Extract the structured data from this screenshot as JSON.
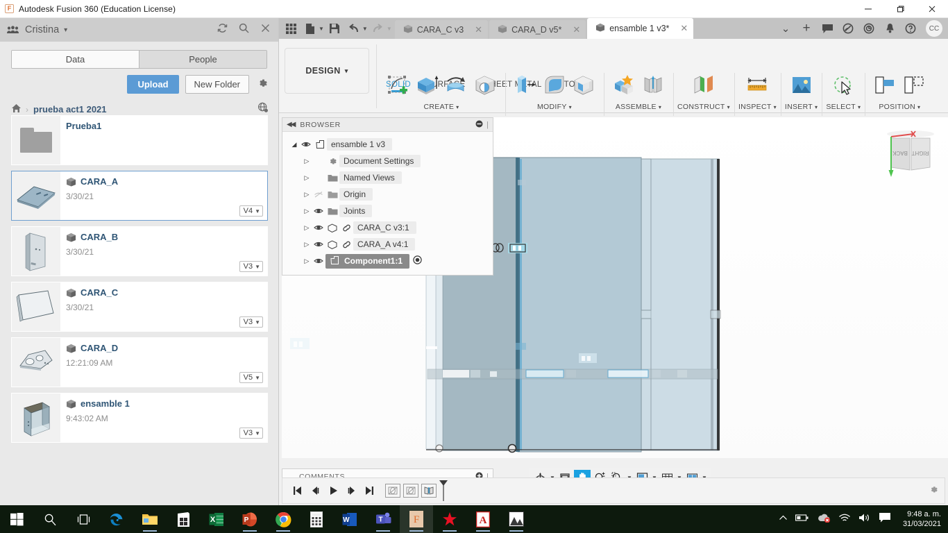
{
  "window": {
    "title": "Autodesk Fusion 360 (Education License)",
    "app_icon": "fusion-logo-icon",
    "minimize": "—",
    "maximize": "❐",
    "close": "✕"
  },
  "data_panel": {
    "user": "Cristina",
    "user_caret": "▾",
    "header_icons": [
      "refresh-icon",
      "search-icon",
      "close-icon"
    ],
    "tabs": [
      {
        "label": "Data",
        "active": true
      },
      {
        "label": "People",
        "active": false
      }
    ],
    "upload_label": "Upload",
    "new_folder_label": "New Folder",
    "settings_icon": "gear-icon",
    "breadcrumb": {
      "home_icon": "home-icon",
      "separator": "›",
      "current": "prueba act1 2021",
      "globe_icon": "globe-icon"
    },
    "items": [
      {
        "name": "Prueba1",
        "date": "",
        "version": "",
        "type": "folder",
        "selected": false
      },
      {
        "name": "CARA_A",
        "date": "3/30/21",
        "version": "V4",
        "type": "file",
        "selected": true
      },
      {
        "name": "CARA_B",
        "date": "3/30/21",
        "version": "V3",
        "type": "file",
        "selected": false
      },
      {
        "name": "CARA_C",
        "date": "3/30/21",
        "version": "V3",
        "type": "file",
        "selected": false
      },
      {
        "name": "CARA_D",
        "date": "12:21:09 AM",
        "version": "V5",
        "type": "file",
        "selected": false
      },
      {
        "name": "ensamble 1",
        "date": "9:43:02 AM",
        "version": "V3",
        "type": "file",
        "selected": false
      }
    ]
  },
  "quick_access": {
    "grid_icon": "app-grid-icon",
    "new_icon": "new-document-icon",
    "save_icon": "save-icon",
    "undo_icon": "undo-icon",
    "redo_icon": "redo-icon"
  },
  "document_tabs": [
    {
      "label": "CARA_C v3",
      "active": false,
      "close": "✕"
    },
    {
      "label": "CARA_D v5*",
      "active": false,
      "close": "✕"
    },
    {
      "label": "ensamble 1 v3*",
      "active": true,
      "close": "✕"
    }
  ],
  "tabs_overflow_caret": "⌄",
  "tabs_add": "+",
  "tab_tools": [
    "comments-icon",
    "job-status-icon",
    "recent-icon",
    "notifications-icon",
    "help-icon"
  ],
  "avatar_initials": "CC",
  "ribbon": {
    "design_label": "DESIGN",
    "design_caret": "▾",
    "workspace_tabs": [
      {
        "label": "SOLID",
        "active": true
      },
      {
        "label": "SURFACE",
        "active": false
      },
      {
        "label": "SHEET METAL",
        "active": false
      },
      {
        "label": "TOOLS",
        "active": false
      }
    ],
    "groups": [
      {
        "label": "CREATE",
        "caret": "▾",
        "icons": [
          "new-sketch-icon",
          "extrude-icon",
          "revolve-icon",
          "hole-icon"
        ]
      },
      {
        "label": "MODIFY",
        "caret": "▾",
        "icons": [
          "press-pull-icon",
          "fillet-icon",
          "shell-icon"
        ]
      },
      {
        "label": "ASSEMBLE",
        "caret": "▾",
        "icons": [
          "new-component-icon",
          "joint-icon"
        ]
      },
      {
        "label": "CONSTRUCT",
        "caret": "▾",
        "icons": [
          "offset-plane-icon"
        ]
      },
      {
        "label": "INSPECT",
        "caret": "▾",
        "icons": [
          "measure-icon"
        ]
      },
      {
        "label": "INSERT",
        "caret": "▾",
        "icons": [
          "insert-image-icon"
        ]
      },
      {
        "label": "SELECT",
        "caret": "▾",
        "icons": [
          "select-cursor-icon"
        ]
      },
      {
        "label": "POSITION",
        "caret": "▾",
        "icons": [
          "align-icon",
          "move-copy-icon"
        ]
      }
    ]
  },
  "browser": {
    "title": "BROWSER",
    "collapse_icon": "collapse-left-icon",
    "minimize_icon": "minus-circle-icon",
    "nodes": [
      {
        "label": "ensamble 1 v3",
        "indent": 0,
        "arrow": "◢",
        "icon": "assembly-icon",
        "eye": "visible",
        "selected": false
      },
      {
        "label": "Document Settings",
        "indent": 1,
        "arrow": "▷",
        "icon": "gear-icon",
        "eye": "none",
        "selected": false
      },
      {
        "label": "Named Views",
        "indent": 1,
        "arrow": "▷",
        "icon": "folder-icon",
        "eye": "none",
        "selected": false
      },
      {
        "label": "Origin",
        "indent": 1,
        "arrow": "▷",
        "icon": "folder-icon",
        "eye": "hidden",
        "selected": false
      },
      {
        "label": "Joints",
        "indent": 1,
        "arrow": "▷",
        "icon": "folder-icon",
        "eye": "visible",
        "selected": false
      },
      {
        "label": "CARA_C v3:1",
        "indent": 1,
        "arrow": "▷",
        "icon": "body-link-icon",
        "eye": "visible",
        "selected": false
      },
      {
        "label": "CARA_A v4:1",
        "indent": 1,
        "arrow": "▷",
        "icon": "body-link-icon",
        "eye": "visible",
        "selected": false
      },
      {
        "label": "Component1:1",
        "indent": 1,
        "arrow": "▷",
        "icon": "component-icon",
        "eye": "visible",
        "selected": true,
        "radio": "activated-radio-icon"
      }
    ]
  },
  "comments": {
    "title": "COMMENTS",
    "add_icon": "add-circle-icon"
  },
  "view_cube": {
    "face_left": "BACK",
    "face_right": "RIGHT",
    "axis_x_color": "#e04d4d",
    "axis_y_color": "#4ec44e"
  },
  "nav_bar": {
    "items": [
      {
        "icon": "orbit-icon",
        "selected": false,
        "caret": "▾"
      },
      {
        "icon": "look-at-icon",
        "selected": false,
        "caret": ""
      },
      {
        "icon": "pan-hand-icon",
        "selected": true,
        "caret": ""
      },
      {
        "icon": "zoom-icon",
        "selected": false,
        "caret": ""
      },
      {
        "icon": "zoom-window-icon",
        "selected": false,
        "caret": "▾"
      },
      {
        "icon": "display-settings-icon",
        "selected": false,
        "caret": "▾"
      },
      {
        "icon": "grid-snap-icon",
        "selected": false,
        "caret": "▾"
      },
      {
        "icon": "viewports-icon",
        "selected": false,
        "caret": "▾"
      }
    ]
  },
  "timeline": {
    "buttons": [
      "go-to-beginning-icon",
      "step-back-icon",
      "play-icon",
      "step-forward-icon",
      "go-to-end-icon"
    ],
    "features": [
      "joint-feature-icon",
      "joint-feature-icon",
      "joint-feature-icon"
    ],
    "settings_icon": "gear-icon"
  },
  "taskbar": {
    "apps": [
      {
        "icon": "windows-start-icon",
        "name": "start-button",
        "running": false,
        "active": false
      },
      {
        "icon": "search-icon",
        "name": "search-button",
        "running": false,
        "active": false
      },
      {
        "icon": "task-view-icon",
        "name": "task-view-button",
        "running": false,
        "active": false
      },
      {
        "icon": "edge-icon",
        "name": "edge",
        "running": false,
        "active": false
      },
      {
        "icon": "file-explorer-icon",
        "name": "file-explorer",
        "running": true,
        "active": false
      },
      {
        "icon": "microsoft-store-icon",
        "name": "microsoft-store",
        "running": false,
        "active": false
      },
      {
        "icon": "excel-icon",
        "name": "excel",
        "running": false,
        "active": false
      },
      {
        "icon": "powerpoint-icon",
        "name": "powerpoint",
        "running": true,
        "active": false
      },
      {
        "icon": "chrome-icon",
        "name": "chrome",
        "running": true,
        "active": false
      },
      {
        "icon": "calculator-icon",
        "name": "calculator",
        "running": false,
        "active": false
      },
      {
        "icon": "word-icon",
        "name": "word",
        "running": false,
        "active": false
      },
      {
        "icon": "teams-icon",
        "name": "teams",
        "running": true,
        "active": false
      },
      {
        "icon": "fusion360-icon",
        "name": "fusion-360",
        "running": true,
        "active": true
      },
      {
        "icon": "inventor-icon",
        "name": "inventor",
        "running": true,
        "active": false
      },
      {
        "icon": "acrobat-icon",
        "name": "acrobat-reader",
        "running": true,
        "active": false
      },
      {
        "icon": "photos-icon",
        "name": "photos",
        "running": true,
        "active": false
      }
    ],
    "tray": {
      "chevron": "∧",
      "icons": [
        "battery-icon",
        "onedrive-error-icon",
        "wifi-icon",
        "volume-icon",
        "action-center-icon"
      ],
      "time": "9:48 a. m.",
      "date": "31/03/2021"
    }
  },
  "colors": {
    "accent_blue": "#2e9bd6",
    "upload_blue": "#5b9bd5",
    "panel_gray": "#e9e9e9",
    "tabstrip_gray": "#c3c3c3",
    "taskbar": "#0d1a0d"
  }
}
